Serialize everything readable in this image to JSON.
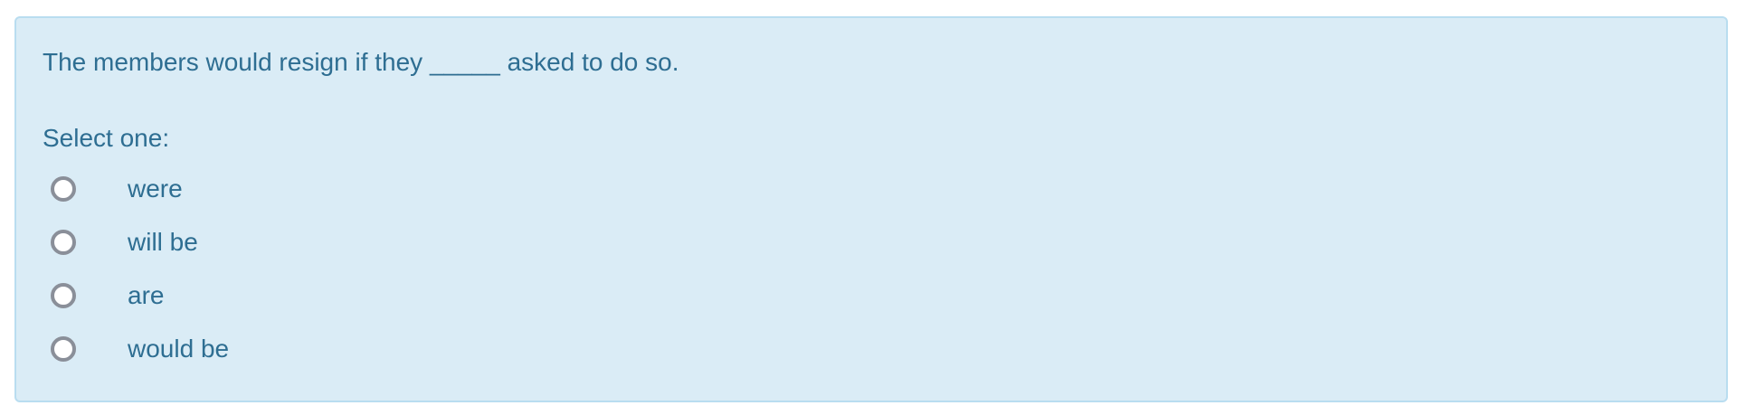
{
  "question": {
    "text": "The members would resign if they _____ asked to do so.",
    "prompt": "Select one:",
    "options": [
      {
        "label": "were",
        "selected": false
      },
      {
        "label": "will be",
        "selected": false
      },
      {
        "label": "are",
        "selected": false
      },
      {
        "label": "would be",
        "selected": false
      }
    ]
  },
  "colors": {
    "box_background": "#daecf6",
    "box_border": "#b9ddf0",
    "text": "#2e6e92",
    "radio_border": "#8a8f99"
  }
}
